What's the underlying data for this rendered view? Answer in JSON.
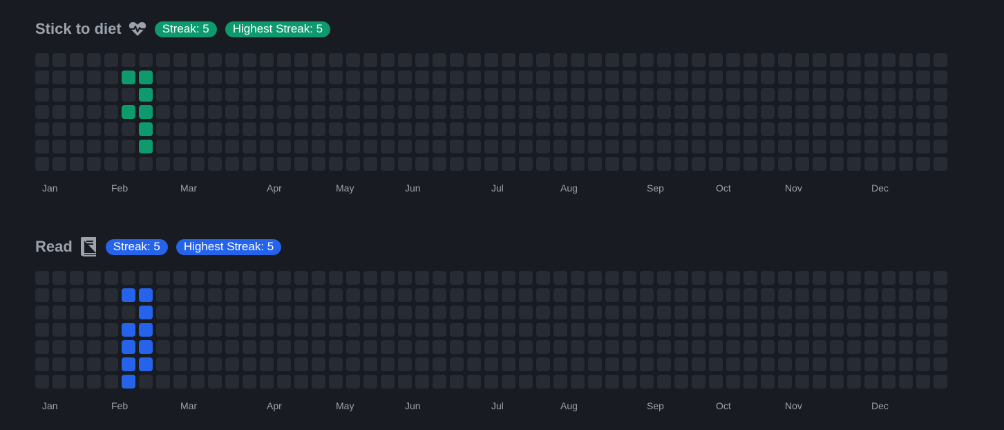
{
  "colors": {
    "empty_cell": "#262b34",
    "background": "#181b21"
  },
  "habits": [
    {
      "title": "Stick to diet",
      "icon": "heart-pulse-icon",
      "accent": "#0e9a6c",
      "streak_label": "Streak: 5",
      "highest_streak_label": "Highest Streak: 5",
      "filled": [
        [
          5,
          1
        ],
        [
          6,
          1
        ],
        [
          6,
          2
        ],
        [
          5,
          3
        ],
        [
          6,
          3
        ],
        [
          6,
          4
        ],
        [
          6,
          5
        ]
      ]
    },
    {
      "title": "Read",
      "icon": "book-icon",
      "accent": "#2563eb",
      "streak_label": "Streak: 5",
      "highest_streak_label": "Highest Streak: 5",
      "filled": [
        [
          5,
          1
        ],
        [
          6,
          1
        ],
        [
          6,
          2
        ],
        [
          5,
          3
        ],
        [
          6,
          3
        ],
        [
          5,
          4
        ],
        [
          6,
          4
        ],
        [
          5,
          5
        ],
        [
          6,
          5
        ],
        [
          5,
          6
        ]
      ]
    }
  ],
  "months": [
    {
      "label": "Jan",
      "week": 0
    },
    {
      "label": "Feb",
      "week": 4
    },
    {
      "label": "Mar",
      "week": 8
    },
    {
      "label": "Apr",
      "week": 13
    },
    {
      "label": "May",
      "week": 17
    },
    {
      "label": "Jun",
      "week": 21
    },
    {
      "label": "Jul",
      "week": 26
    },
    {
      "label": "Aug",
      "week": 30
    },
    {
      "label": "Sep",
      "week": 35
    },
    {
      "label": "Oct",
      "week": 39
    },
    {
      "label": "Nov",
      "week": 43
    },
    {
      "label": "Dec",
      "week": 48
    }
  ],
  "grid": {
    "weeks": 53,
    "days": 7
  }
}
